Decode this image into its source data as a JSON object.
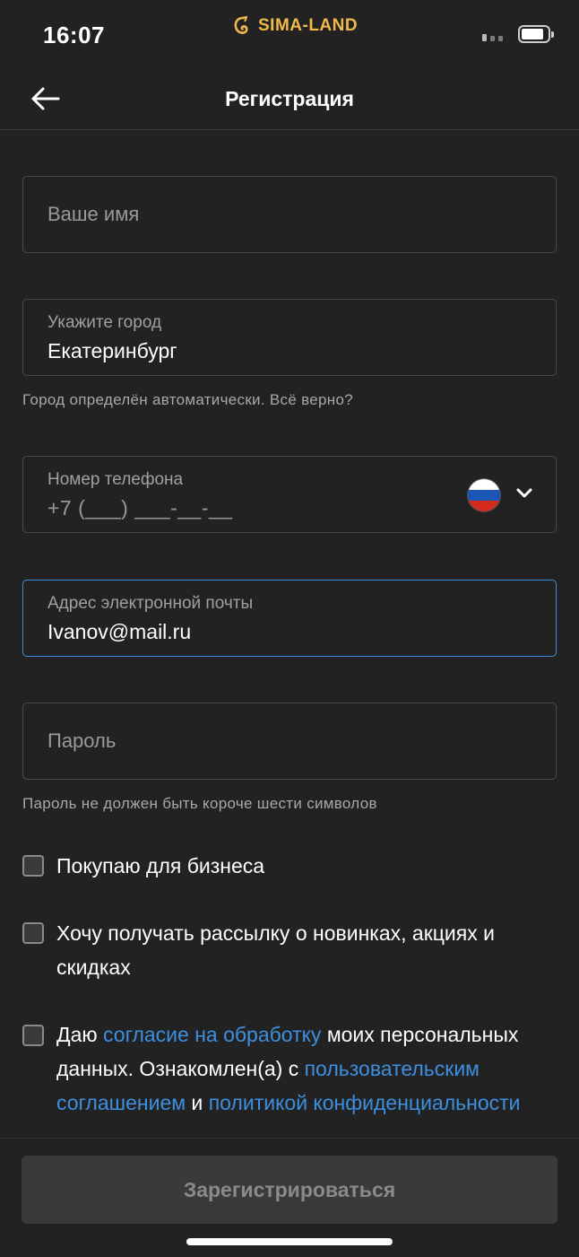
{
  "status_bar": {
    "time": "16:07",
    "brand": "SIMA-LAND",
    "brand_color": "#f1b84a"
  },
  "nav": {
    "back_icon": "arrow-left-icon",
    "title": "Регистрация"
  },
  "form": {
    "name_field": {
      "placeholder": "Ваше имя"
    },
    "city_field": {
      "label": "Укажите город",
      "value": "Екатеринбург"
    },
    "city_hint": "Город определён автоматически. Всё верно?",
    "phone_field": {
      "label": "Номер телефона",
      "value": "+7 (___) ___-__-__",
      "country_flag": "russia-flag-icon",
      "dropdown_icon": "chevron-down-icon"
    },
    "email_field": {
      "label": "Адрес электронной почты",
      "value": "Ivanov@mail.ru",
      "focused": true
    },
    "password_field": {
      "placeholder": "Пароль"
    },
    "password_hint": "Пароль не должен быть короче шести символов"
  },
  "checkboxes": {
    "business": {
      "label": "Покупаю для бизнеса",
      "checked": false
    },
    "newsletter": {
      "label": "Хочу получать рассылку о новинках, акциях и скидках",
      "checked": false
    },
    "consent": {
      "checked": false,
      "text_1": "Даю ",
      "link_1": "согласие на обработку",
      "text_2": " моих персональных данных. Ознакомлен(а) с ",
      "link_2": "пользовательским соглашением",
      "text_3": " и ",
      "link_3": "политикой конфиденциальности"
    }
  },
  "footer": {
    "register_label": "Зарегистрироваться"
  },
  "colors": {
    "background": "#222222",
    "accent": "#3d8fe0",
    "focus_border": "#3a8fe0"
  }
}
